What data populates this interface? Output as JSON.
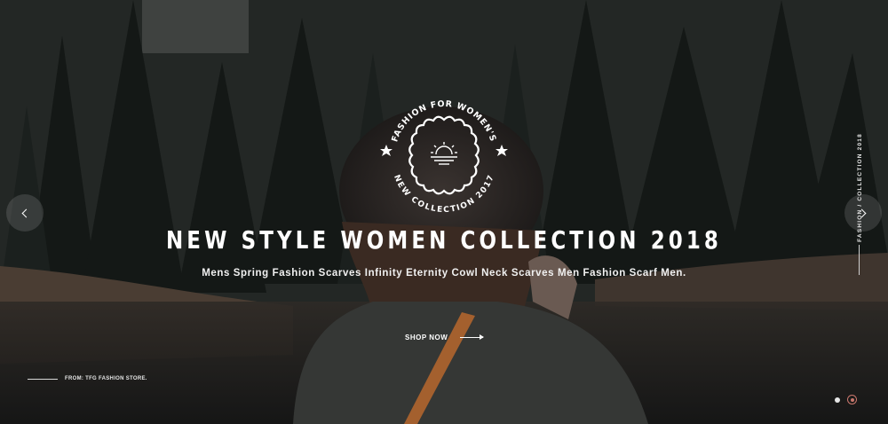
{
  "hero": {
    "badge": {
      "top_text": "FASHION FOR WOMEN'S",
      "bottom_text": "NEW COLLECTION 2017"
    },
    "headline": "NEW STYLE WOMEN COLLECTION 2018",
    "subtitle": "Mens Spring Fashion Scarves Infinity Eternity Cowl Neck Scarves Men Fashion Scarf Men.",
    "cta_label": "SHOP NOW",
    "from_text": "FROM: TFG FASHION STORE.",
    "side_label": "FASHION / COLLECTION 2018"
  },
  "slider": {
    "slide_count": 2,
    "active_index": 1
  },
  "colors": {
    "accent": "#c9776d",
    "text": "#ffffff"
  },
  "icons": {
    "prev": "chevron-left-icon",
    "next": "chevron-right-icon",
    "cta": "arrow-right-icon",
    "badge": "sunset-icon"
  }
}
